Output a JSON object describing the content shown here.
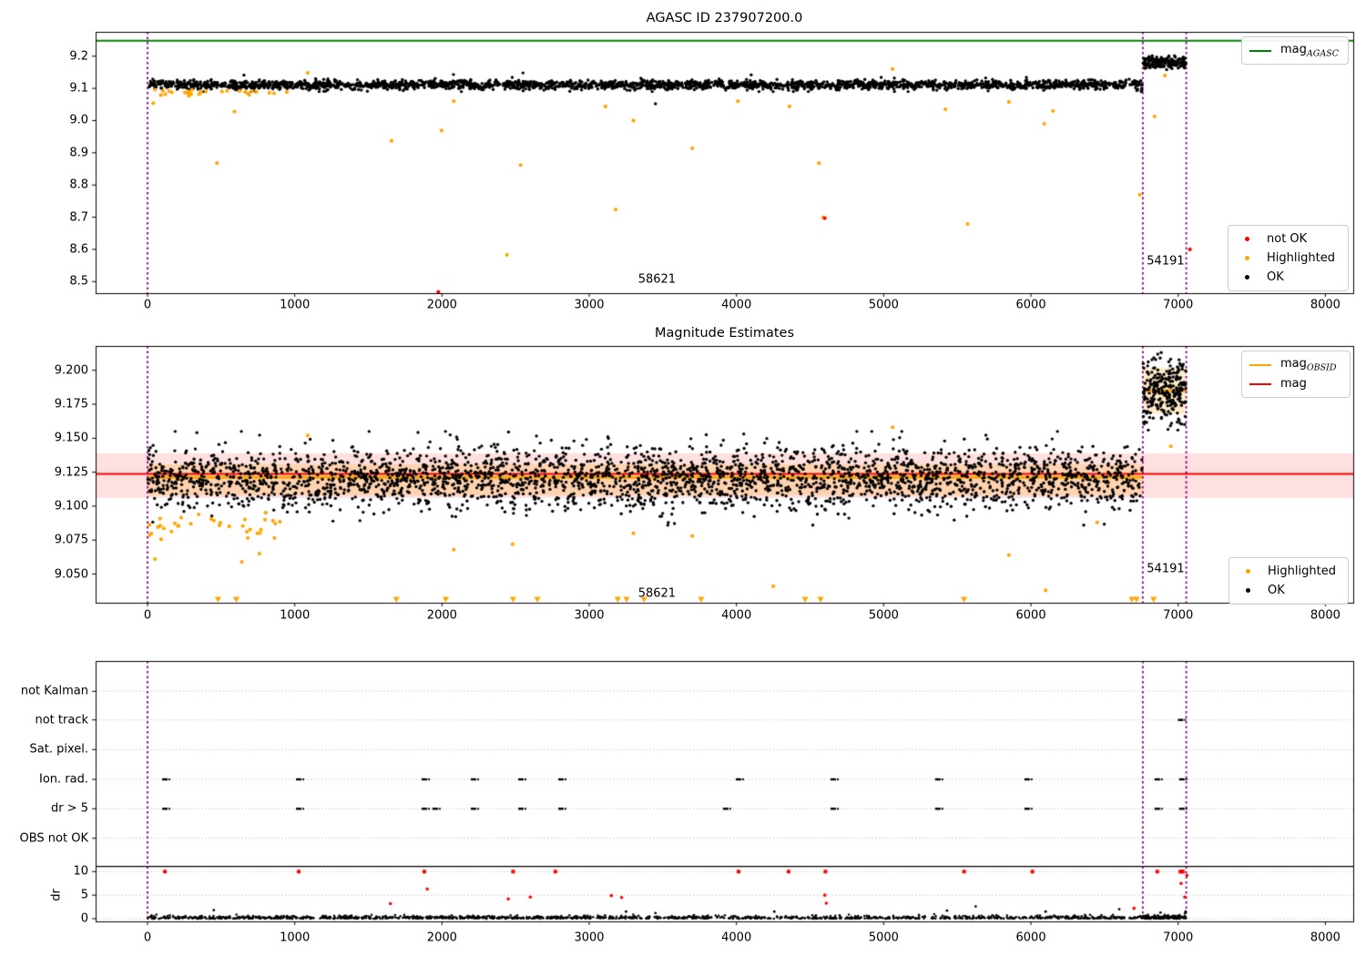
{
  "theme": {
    "accent_green": "#008000",
    "accent_orange": "#ffa500",
    "accent_red": "#ff0000",
    "accent_purple": "#800080",
    "point_black": "#000000",
    "band_pink": "rgba(255,0,0,0.12)",
    "band_wheat": "rgba(255,165,0,0.22)",
    "grid_gray": "#c8c8c8"
  },
  "titles": {
    "top": "AGASC ID 237907200.0",
    "middle": "Magnitude Estimates"
  },
  "legends": {
    "agasc": {
      "text": "mag",
      "sub": "AGASC"
    },
    "status_top": {
      "not_ok": "not OK",
      "highlighted": "Highlighted",
      "ok": "OK"
    },
    "obsid": {
      "text": "mag",
      "sub": "OBSID",
      "mag": "mag"
    },
    "status_mid": {
      "highlighted": "Highlighted",
      "ok": "OK"
    }
  },
  "chart_data": [
    {
      "id": "mag-overview",
      "type": "scatter",
      "title": "AGASC ID 237907200.0",
      "xlim": [
        -352,
        8188
      ],
      "ylim": [
        8.464,
        9.275
      ],
      "xtick_values": [
        0,
        1000,
        2000,
        3000,
        4000,
        5000,
        6000,
        7000,
        8000
      ],
      "xtick_labels": [
        "0",
        "1000",
        "2000",
        "3000",
        "4000",
        "5000",
        "6000",
        "7000",
        "8000"
      ],
      "ytick_values": [
        9.2,
        9.1,
        9.0,
        8.9,
        8.8,
        8.7,
        8.6,
        8.5
      ],
      "ytick_labels": [
        "9.2",
        "9.1",
        "9.0",
        "8.9",
        "8.8",
        "8.7",
        "8.6",
        "8.5"
      ],
      "hlines": [
        {
          "y": 9.248,
          "color": "#008000",
          "label": "mag_AGASC",
          "width": 2
        }
      ],
      "vlines": [
        0,
        6760,
        7055
      ],
      "series": [
        {
          "name": "OK",
          "color": "#000000",
          "r": 1.7,
          "generate": {
            "seed": 11,
            "n": 2400,
            "xrange": [
              2,
              6758
            ],
            "mean": 9.111,
            "sd": 0.0072,
            "clip": [
              9.09,
              9.134
            ]
          }
        },
        {
          "name": "OK-jump",
          "color": "#000000",
          "r": 1.7,
          "generate": {
            "seed": 12,
            "n": 190,
            "xrange": [
              6762,
              7052
            ],
            "mean": 9.181,
            "sd": 0.0085,
            "clip": [
              9.158,
              9.205
            ]
          }
        },
        {
          "name": "OK-strays",
          "color": "#000000",
          "r": 1.7,
          "points": [
            [
              2078,
              9.143
            ],
            [
              2550,
              9.148
            ],
            [
              4100,
              9.142
            ],
            [
              655,
              9.141
            ],
            [
              3450,
              9.052
            ]
          ]
        },
        {
          "name": "Highlighted-bandhug",
          "color": "#ffa500",
          "r": 2.1,
          "generate": {
            "seed": 13,
            "n": 28,
            "xrange": [
              5,
              950
            ],
            "mean": 9.086,
            "sd": 0.005,
            "clip": [
              9.072,
              9.096
            ]
          }
        },
        {
          "name": "Highlighted",
          "color": "#ffa500",
          "r": 2.1,
          "points": [
            [
              39,
              9.054
            ],
            [
              472,
              8.868
            ],
            [
              590,
              9.028
            ],
            [
              1088,
              9.148
            ],
            [
              1657,
              8.937
            ],
            [
              1997,
              8.969
            ],
            [
              2080,
              9.06
            ],
            [
              2441,
              8.583
            ],
            [
              2534,
              8.862
            ],
            [
              3110,
              9.044
            ],
            [
              3180,
              8.724
            ],
            [
              3300,
              9.0
            ],
            [
              3700,
              8.914
            ],
            [
              4010,
              9.06
            ],
            [
              4360,
              9.044
            ],
            [
              4560,
              8.868
            ],
            [
              4589,
              8.699
            ],
            [
              5060,
              9.16
            ],
            [
              5420,
              9.035
            ],
            [
              5570,
              8.679
            ],
            [
              5850,
              9.058
            ],
            [
              6090,
              8.99
            ],
            [
              6150,
              9.03
            ],
            [
              6740,
              8.77
            ],
            [
              6840,
              9.013
            ],
            [
              6910,
              9.14
            ]
          ]
        },
        {
          "name": "not OK",
          "color": "#ff0000",
          "r": 2.1,
          "points": [
            [
              1975,
              8.468
            ],
            [
              4600,
              8.697
            ],
            [
              7080,
              8.6
            ]
          ]
        }
      ],
      "annotations": [
        {
          "text": "58621",
          "x": 3460,
          "y": 8.507
        },
        {
          "text": "54191",
          "x": 6915,
          "y": 8.563
        }
      ]
    },
    {
      "id": "magnitude-estimates",
      "type": "scatter",
      "title": "Magnitude Estimates",
      "xlim": [
        -352,
        8188
      ],
      "ylim": [
        9.029,
        9.218
      ],
      "xtick_values": [
        0,
        1000,
        2000,
        3000,
        4000,
        5000,
        6000,
        7000,
        8000
      ],
      "xtick_labels": [
        "0",
        "1000",
        "2000",
        "3000",
        "4000",
        "5000",
        "6000",
        "7000",
        "8000"
      ],
      "ytick_values": [
        9.2,
        9.175,
        9.15,
        9.125,
        9.1,
        9.075,
        9.05
      ],
      "ytick_labels": [
        "9.200",
        "9.175",
        "9.150",
        "9.125",
        "9.100",
        "9.075",
        "9.050"
      ],
      "hlines": [
        {
          "y": 9.1238,
          "color": "#ff0000",
          "label": "mag",
          "width": 2
        }
      ],
      "mag_obsid_segments": [
        {
          "x0": 0,
          "x1": 6760,
          "y": 9.1212
        },
        {
          "x0": 6760,
          "x1": 7055,
          "y": 9.185
        }
      ],
      "bands": {
        "pink_full": {
          "ylo": 9.106,
          "yhi": 9.139
        },
        "wheat_segments": [
          {
            "x0": 0,
            "x1": 6760,
            "ylo": 9.108,
            "yhi": 9.131
          },
          {
            "x0": 6760,
            "x1": 7055,
            "ylo": 9.168,
            "yhi": 9.202
          }
        ]
      },
      "vlines": [
        0,
        6760,
        7055
      ],
      "series": [
        {
          "name": "OK",
          "color": "#000000",
          "r": 1.7,
          "generate": {
            "seed": 21,
            "n": 3000,
            "xrange": [
              2,
              6758
            ],
            "mean": 9.1205,
            "sd": 0.0115,
            "clip": [
              9.086,
              9.155
            ]
          }
        },
        {
          "name": "OK-jump",
          "color": "#000000",
          "r": 1.7,
          "generate": {
            "seed": 22,
            "n": 250,
            "xrange": [
              6762,
              7052
            ],
            "mean": 9.1855,
            "sd": 0.0115,
            "clip": [
              9.156,
              9.213
            ]
          }
        },
        {
          "name": "Highlighted-bandhug",
          "color": "#ffa500",
          "r": 2.1,
          "generate": {
            "seed": 23,
            "n": 34,
            "xrange": [
              5,
              950
            ],
            "mean": 9.085,
            "sd": 0.006,
            "clip": [
              9.058,
              9.096
            ]
          }
        },
        {
          "name": "Highlighted",
          "color": "#ffa500",
          "r": 2.1,
          "points": [
            [
              50,
              9.061
            ],
            [
              640,
              9.059
            ],
            [
              760,
              9.065
            ],
            [
              1088,
              9.152
            ],
            [
              2080,
              9.068
            ],
            [
              2480,
              9.072
            ],
            [
              3300,
              9.08
            ],
            [
              3700,
              9.078
            ],
            [
              4250,
              9.041
            ],
            [
              5060,
              9.158
            ],
            [
              5850,
              9.064
            ],
            [
              6100,
              9.038
            ],
            [
              6450,
              9.088
            ],
            [
              6950,
              9.144
            ]
          ]
        }
      ],
      "clipped_below_x": [
        479,
        603,
        1690,
        2026,
        2483,
        2648,
        3194,
        3253,
        3373,
        3760,
        4466,
        4571,
        5546,
        6686,
        6717,
        6833
      ],
      "annotations": [
        {
          "text": "58621",
          "x": 3460,
          "y": 9.0356
        },
        {
          "text": "54191",
          "x": 6915,
          "y": 9.0537
        }
      ]
    },
    {
      "id": "flags-and-dr",
      "type": "scatter",
      "xlim": [
        -352,
        8188
      ],
      "xtick_values": [
        0,
        1000,
        2000,
        3000,
        4000,
        5000,
        6000,
        7000,
        8000
      ],
      "xtick_labels": [
        "0",
        "1000",
        "2000",
        "3000",
        "4000",
        "5000",
        "6000",
        "7000",
        "8000"
      ],
      "flag_rows": [
        "not Kalman",
        "not track",
        "Sat. pixel.",
        "Ion. rad.",
        "dr > 5",
        "OBS not OK"
      ],
      "flag_points": {
        "not track": [
          7017
        ],
        "Ion. rad.": [
          118,
          1027,
          1880,
          2214,
          2536,
          2808,
          4014,
          4657,
          5368,
          5974,
          6858,
          7025
        ],
        "dr > 5": [
          118,
          1027,
          1880,
          1954,
          2214,
          2536,
          2808,
          3927,
          4657,
          5368,
          5974,
          6858,
          7025
        ]
      },
      "dr": {
        "ylabel": "dr",
        "tick_values": [
          10,
          5,
          0
        ],
        "tick_labels": [
          "10",
          "5",
          "0"
        ],
        "ok_generate": {
          "seed": 31,
          "n": 1400,
          "xrange": [
            0,
            7052
          ],
          "sd": 0.3,
          "clip": 1.6
        },
        "ok_extra_generate": {
          "seed": 32,
          "n": 60,
          "xrange": [
            6760,
            7050
          ],
          "mean": 0.45,
          "sd": 0.25,
          "clip": 1.1
        },
        "ok_outliers": [
          [
            450,
            1.8
          ],
          [
            3250,
            1.5
          ],
          [
            3450,
            1.2
          ],
          [
            4257,
            1.5
          ],
          [
            5430,
            1.7
          ],
          [
            5625,
            2.6
          ],
          [
            6100,
            1.5
          ],
          [
            6600,
            2.0
          ],
          [
            6880,
            1.3
          ],
          [
            7050,
            1.5
          ]
        ],
        "red_at_10": [
          118,
          1027,
          1880,
          2483,
          2770,
          4014,
          4354,
          4604,
          5546,
          6010,
          6858,
          7015,
          7025,
          7032
        ],
        "red_scatter": [
          [
            1650,
            3.2
          ],
          [
            1900,
            6.3
          ],
          [
            2450,
            4.2
          ],
          [
            2600,
            4.6
          ],
          [
            3150,
            4.9
          ],
          [
            3220,
            4.5
          ],
          [
            4600,
            5.0
          ],
          [
            4610,
            3.3
          ],
          [
            6700,
            2.2
          ],
          [
            7020,
            7.5
          ],
          [
            7060,
            9.2
          ],
          [
            7045,
            4.6
          ]
        ]
      },
      "separator_line": true,
      "vlines": [
        0,
        6760,
        7055
      ]
    }
  ]
}
